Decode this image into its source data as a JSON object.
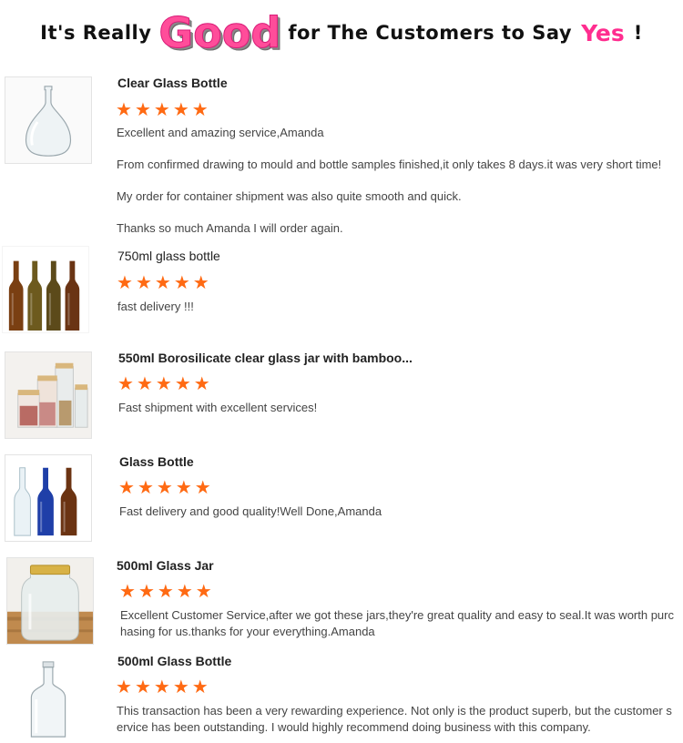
{
  "banner": {
    "part1": "It's Really",
    "good": "Good",
    "part2": "for The Customers to Say",
    "yes": "Yes",
    "end": "!"
  },
  "colors": {
    "star": "#ff6a13",
    "good": "#ff4d9a",
    "yes": "#ff2d8f"
  },
  "reviews": [
    {
      "title": "Clear Glass Bottle",
      "rating": 5,
      "image": "clear-pear-bottle-image",
      "lines": [
        "Excellent and amazing service,Amanda",
        "From confirmed drawing to mould and bottle samples finished,it only takes 8 days.it was very short time!",
        "My order for container shipment was also quite smooth and quick.",
        "Thanks so much Amanda  I will order again."
      ]
    },
    {
      "title": "750ml glass bottle",
      "rating": 5,
      "image": "amber-wine-bottles-image",
      "lines": [
        "fast delivery !!!"
      ]
    },
    {
      "title": "550ml Borosilicate clear glass jar with bamboo...",
      "rating": 5,
      "image": "glass-jars-bamboo-lids-image",
      "lines": [
        "Fast shipment with excellent services!"
      ]
    },
    {
      "title": "Glass Bottle",
      "rating": 5,
      "image": "beer-bottles-image",
      "lines": [
        "Fast delivery and good quality!Well Done,Amanda"
      ]
    },
    {
      "title": "500ml Glass Jar",
      "rating": 5,
      "image": "glass-jar-gold-lid-image",
      "lines": [
        "Excellent Customer Service,after we got these jars,they're great quality and easy to seal.It was worth purchasing for us.thanks for your everything.Amanda"
      ]
    },
    {
      "title": "500ml Glass Bottle",
      "rating": 5,
      "image": "clear-liquor-bottle-image",
      "lines": [
        "This transaction has been a very rewarding experience.  Not only is the product superb, but the customer service has been outstanding.  I would highly recommend doing business with this company."
      ]
    }
  ]
}
